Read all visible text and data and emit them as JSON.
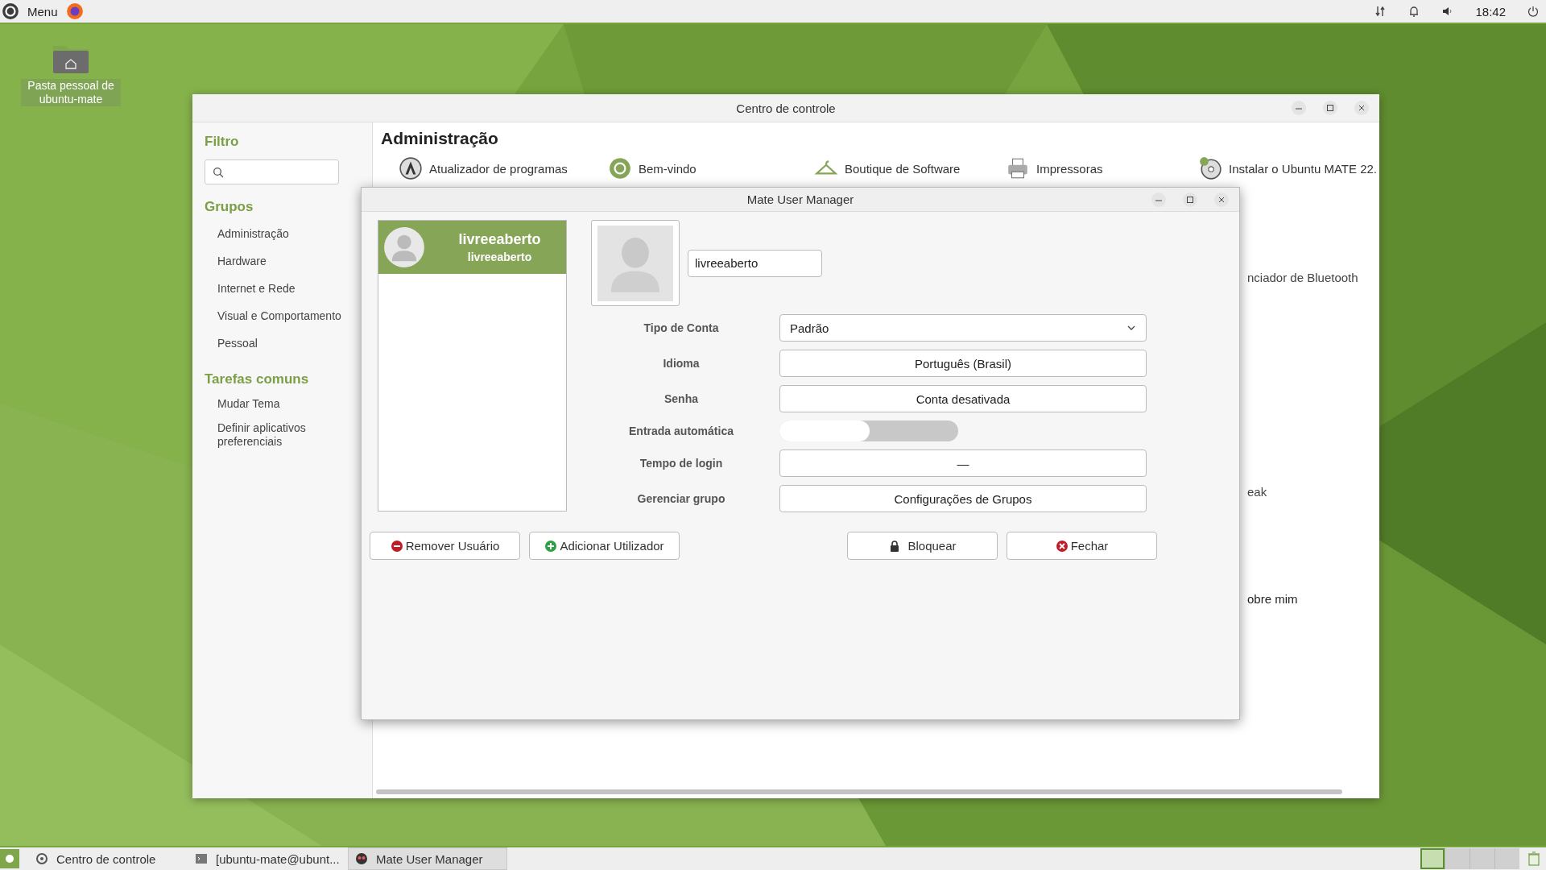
{
  "top_panel": {
    "menu_label": "Menu",
    "clock": "18:42"
  },
  "desktop_icons": [
    {
      "label": "Pasta pessoal de ubuntu-mate"
    }
  ],
  "control_center": {
    "title": "Centro de controle",
    "filter_heading": "Filtro",
    "groups_heading": "Grupos",
    "groups": [
      "Administração",
      "Hardware",
      "Internet e Rede",
      "Visual e Comportamento",
      "Pessoal"
    ],
    "tasks_heading": "Tarefas comuns",
    "tasks": [
      "Mudar Tema",
      "Definir aplicativos preferenciais"
    ],
    "section_title": "Administração",
    "items": [
      {
        "label": "Atualizador de programas",
        "kind": "updater"
      },
      {
        "label": "Bem-vindo",
        "kind": "welcome"
      },
      {
        "label": "Boutique de Software",
        "kind": "boutique"
      },
      {
        "label": "Impressoras",
        "kind": "printer"
      },
      {
        "label": "Instalar o Ubuntu MATE 22.",
        "kind": "installer"
      }
    ],
    "partial_labels": [
      "nciador de Bluetooth",
      "eak",
      "obre mim"
    ]
  },
  "user_manager": {
    "title": "Mate User Manager",
    "users": [
      {
        "name": "livreeaberto",
        "login": "livreeaberto",
        "selected": true
      }
    ],
    "username_value": "livreeaberto",
    "rows": [
      {
        "label": "Tipo de Conta",
        "kind": "dropdown",
        "value": "Padrão"
      },
      {
        "label": "Idioma",
        "kind": "button",
        "value": "Português (Brasil)"
      },
      {
        "label": "Senha",
        "kind": "button",
        "value": "Conta desativada"
      },
      {
        "label": "Entrada automática",
        "kind": "toggle",
        "on": false
      },
      {
        "label": "Tempo de login",
        "kind": "button",
        "value": "—"
      },
      {
        "label": "Gerenciar grupo",
        "kind": "button",
        "value": "Configurações de Grupos"
      }
    ],
    "buttons": [
      {
        "label": "Remover Usuário",
        "kind": "remove"
      },
      {
        "label": "Adicionar Utilizador",
        "kind": "add"
      },
      {
        "label": "Bloquear",
        "kind": "lock"
      },
      {
        "label": "Fechar",
        "kind": "close"
      }
    ]
  },
  "taskbar": {
    "items": [
      {
        "label": "Centro de controle",
        "kind": "settings",
        "selected": false
      },
      {
        "label": "[ubuntu-mate@ubunt...",
        "kind": "terminal",
        "selected": false
      },
      {
        "label": "Mate User Manager",
        "kind": "users",
        "selected": true
      }
    ]
  }
}
